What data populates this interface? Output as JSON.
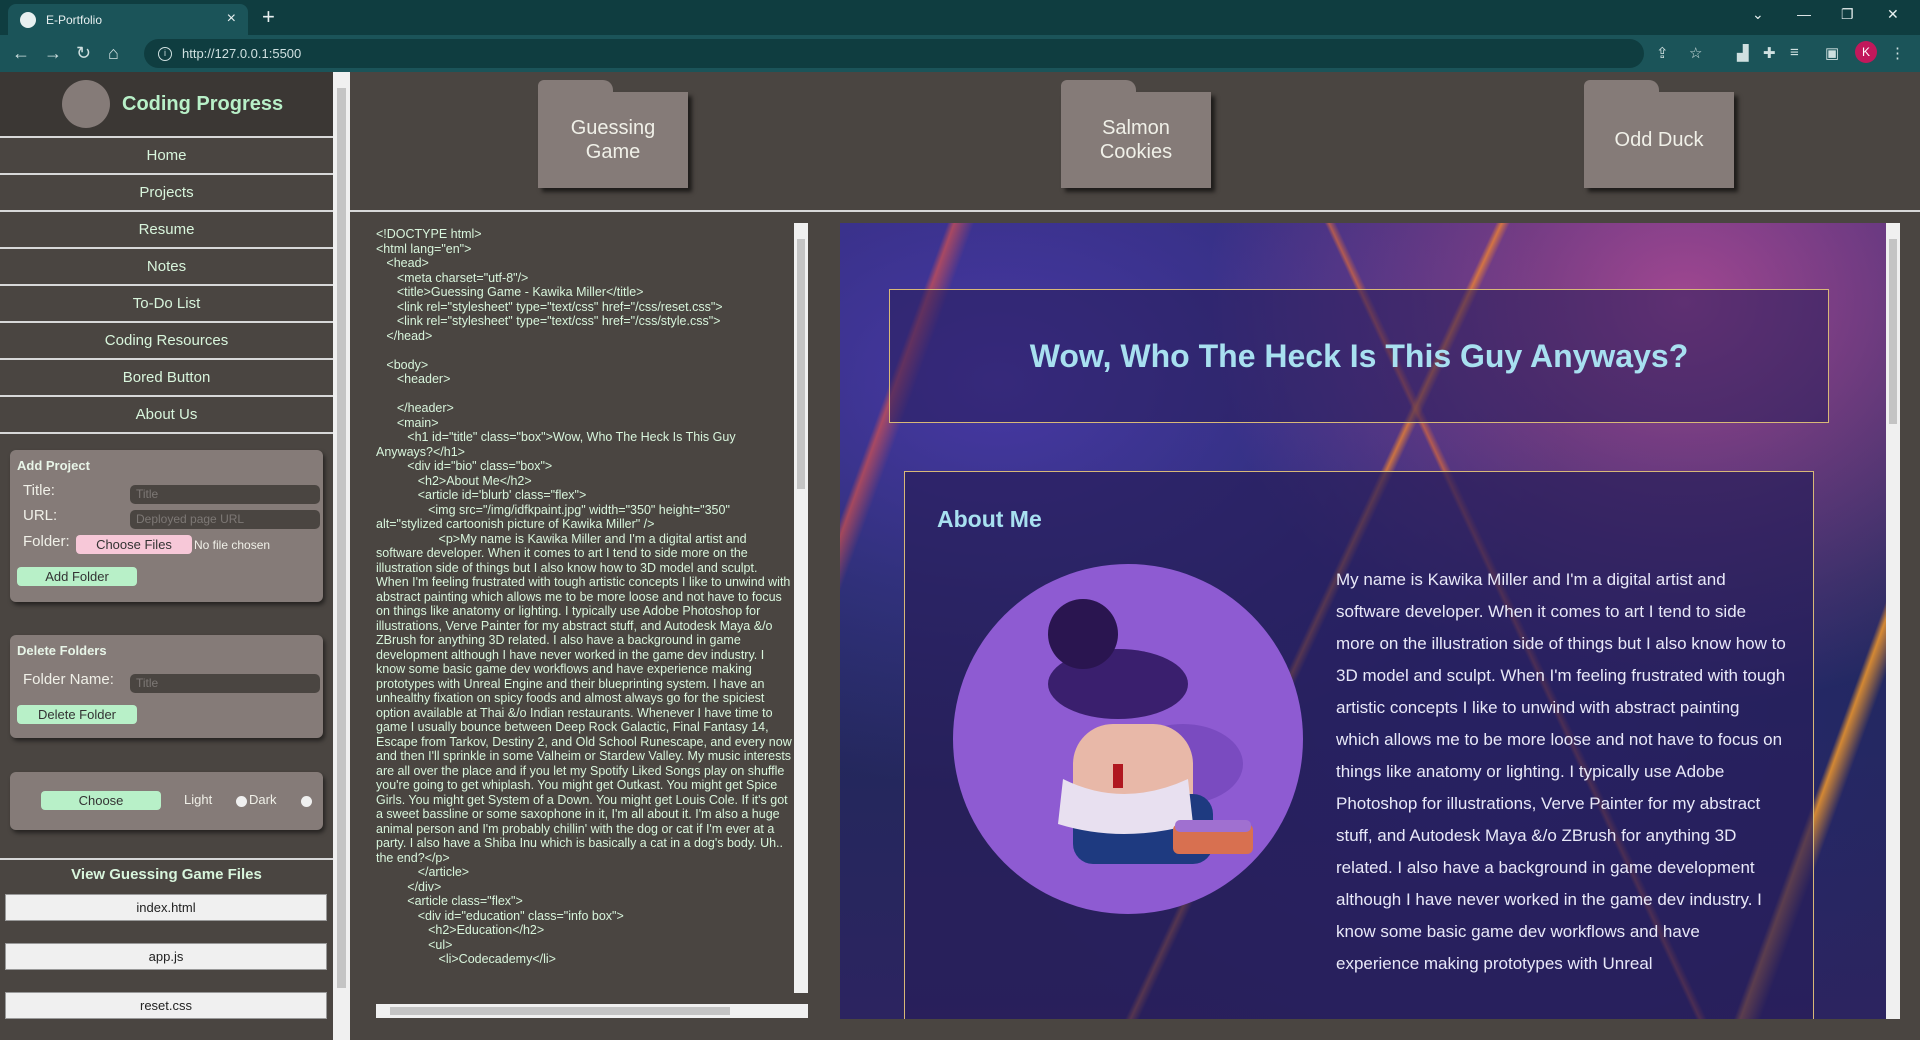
{
  "browser": {
    "tab_title": "E-Portfolio",
    "url": "http://127.0.0.1:5500",
    "profile_initial": "K"
  },
  "sidebar": {
    "brand_title": "Coding Progress",
    "nav": [
      "Home",
      "Projects",
      "Resume",
      "Notes",
      "To-Do List",
      "Coding Resources",
      "Bored Button",
      "About Us"
    ],
    "add_project": {
      "title": "Add Project",
      "title_label": "Title:",
      "title_placeholder": "Title",
      "url_label": "URL:",
      "url_placeholder": "Deployed page URL",
      "folder_label": "Folder:",
      "choose_files": "Choose Files",
      "no_file": "No file chosen",
      "add_button": "Add Folder"
    },
    "delete_folders": {
      "title": "Delete Folders",
      "name_label": "Folder Name:",
      "name_placeholder": "Title",
      "delete_button": "Delete Folder"
    },
    "theme": {
      "choose_button": "Choose",
      "light_label": "Light",
      "dark_label": "Dark"
    },
    "files": {
      "title": "View Guessing Game Files",
      "items": [
        "index.html",
        "app.js",
        "reset.css"
      ]
    }
  },
  "folders": [
    "Guessing Game",
    "Salmon Cookies",
    "Odd Duck"
  ],
  "code": "<!DOCTYPE html>\n<html lang=\"en\">\n   <head>\n      <meta charset=\"utf-8\"/>\n      <title>Guessing Game - Kawika Miller</title>\n      <link rel=\"stylesheet\" type=\"text/css\" href=\"/css/reset.css\">\n      <link rel=\"stylesheet\" type=\"text/css\" href=\"/css/style.css\">\n   </head>\n\n   <body>\n      <header>\n\n      </header>\n      <main>\n         <h1 id=\"title\" class=\"box\">Wow, Who The Heck Is This Guy Anyways?</h1>\n         <div id=\"bio\" class=\"box\">\n            <h2>About Me</h2>\n            <article id='blurb' class=\"flex\">\n               <img src=\"/img/idfkpaint.jpg\" width=\"350\" height=\"350\" alt=\"stylized cartoonish picture of Kawika Miller\" />\n                  <p>My name is Kawika Miller and I'm a digital artist and software developer. When it comes to art I tend to side more on the illustration side of things but I also know how to 3D model and sculpt. When I'm feeling frustrated with tough artistic concepts I like to unwind with abstract painting which allows me to be more loose and not have to focus on things like anatomy or lighting. I typically use Adobe Photoshop for illustrations, Verve Painter for my abstract stuff, and Autodesk Maya &/o ZBrush for anything 3D related. I also have a background in game development although I have never worked in the game dev industry. I know some basic game dev workflows and have experience making prototypes with Unreal Engine and their blueprinting system. I have an unhealthy fixation on spicy foods and almost always go for the spiciest option available at Thai &/o Indian restaurants. Whenever I have time to game I usually bounce between Deep Rock Galactic, Final Fantasy 14, Escape from Tarkov, Destiny 2, and Old School Runescape, and every now and then I'll sprinkle in some Valheim or Stardew Valley. My music interests are all over the place and if you let my Spotify Liked Songs play on shuffle you're going to get whiplash. You might get Outkast. You might get Spice Girls. You might get System of a Down. You might get Louis Cole. If it's got a sweet bassline or some saxophone in it, I'm all about it. I'm also a huge animal person and I'm probably chillin' with the dog or cat if I'm ever at a party. I also have a Shiba Inu which is basically a cat in a dog's body. Uh.. the end?</p>\n            </article>\n         </div>\n         <article class=\"flex\">\n            <div id=\"education\" class=\"info box\">\n               <h2>Education</h2>\n               <ul>\n                  <li>Codecademy</li>",
  "preview": {
    "heading": "Wow, Who The Heck Is This Guy Anyways?",
    "about_title": "About Me",
    "about_text": "My name is Kawika Miller and I'm a digital artist and software developer. When it comes to art I tend to side more on the illustration side of things but I also know how to 3D model and sculpt. When I'm feeling frustrated with tough artistic concepts I like to unwind with abstract painting which allows me to be more loose and not have to focus on things like anatomy or lighting. I typically use Adobe Photoshop for illustrations, Verve Painter for my abstract stuff, and Autodesk Maya &/o ZBrush for anything 3D related. I also have a background in game development although I have never worked in the game dev industry. I know some basic game dev workflows and have experience making prototypes with Unreal"
  }
}
